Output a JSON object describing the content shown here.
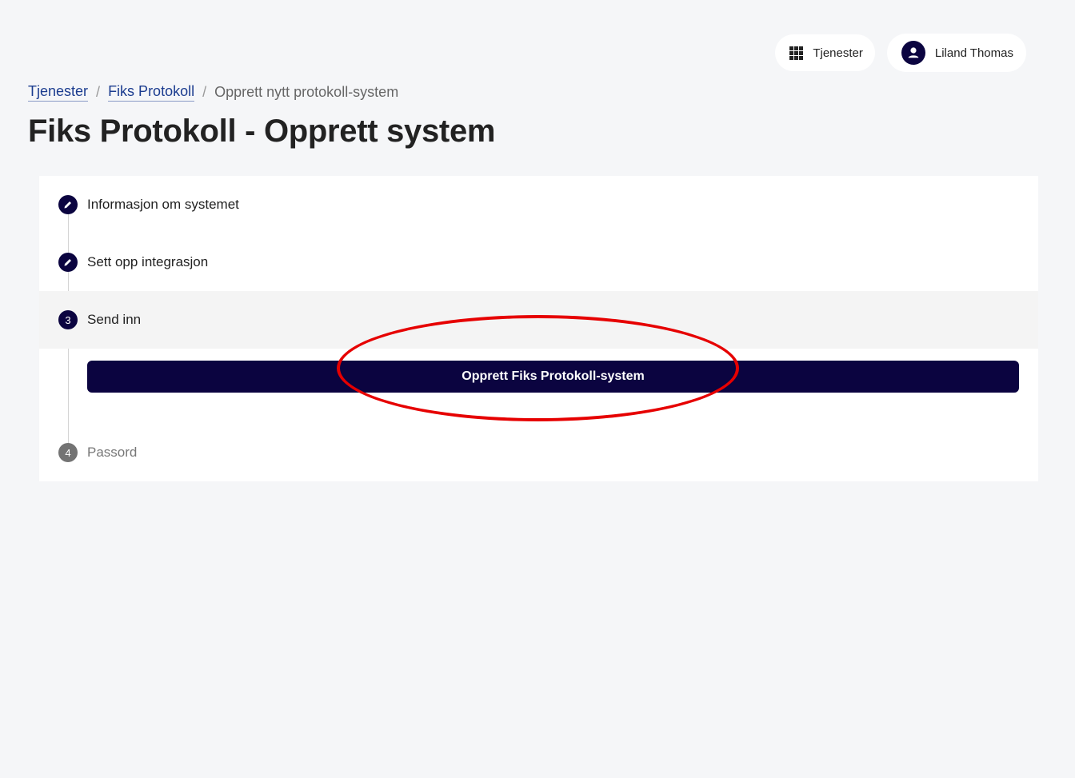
{
  "header": {
    "services_label": "Tjenester",
    "user_name": "Liland Thomas"
  },
  "breadcrumb": {
    "items": [
      "Tjenester",
      "Fiks Protokoll"
    ],
    "current": "Opprett nytt protokoll-system"
  },
  "page_title": "Fiks Protokoll - Opprett system",
  "stepper": {
    "steps": [
      {
        "label": "Informasjon om systemet",
        "state": "edit"
      },
      {
        "label": "Sett opp integrasjon",
        "state": "edit"
      },
      {
        "label": "Send inn",
        "number": "3",
        "state": "active"
      },
      {
        "label": "Passord",
        "number": "4",
        "state": "inactive"
      }
    ],
    "submit_label": "Opprett Fiks Protokoll-system"
  },
  "colors": {
    "primary": "#0b0440",
    "link": "#1b3c8f",
    "annotation": "#e60000"
  }
}
